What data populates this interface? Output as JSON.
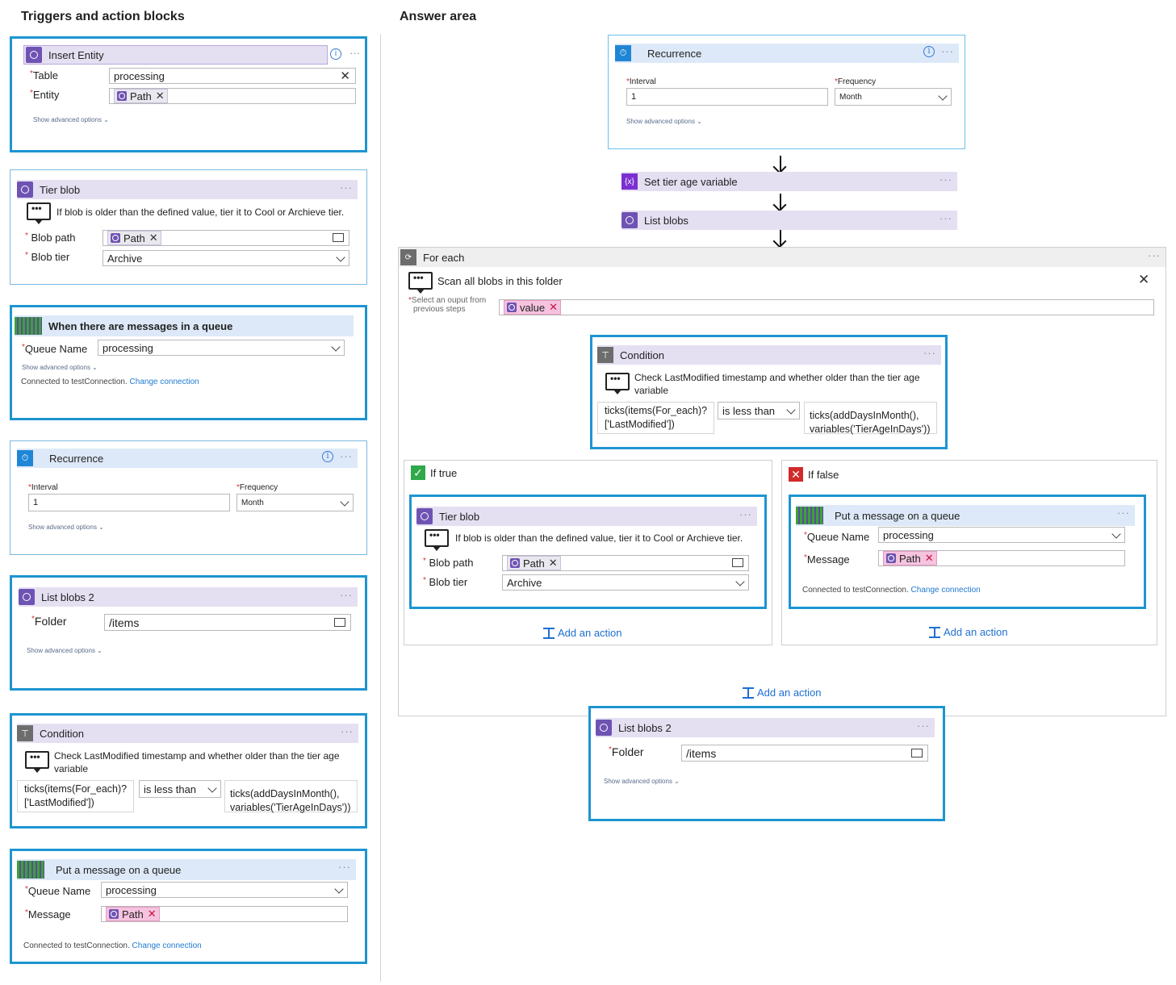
{
  "left_heading": "Triggers and action blocks",
  "right_heading": "Answer area",
  "insert_entity": {
    "title": "Insert Entity",
    "table_label": "Table",
    "table_value": "processing",
    "entity_label": "Entity",
    "entity_token": "Path",
    "advanced": "Show advanced options"
  },
  "tier_blob": {
    "title": "Tier blob",
    "comment": "If blob is older than the defined value, tier it to Cool or Archieve tier.",
    "blob_path_label": "Blob path",
    "blob_path_token": "Path",
    "blob_tier_label": "Blob tier",
    "blob_tier_value": "Archive"
  },
  "queue_trigger": {
    "title": "When there are messages in a queue",
    "queue_label": "Queue Name",
    "queue_value": "processing",
    "advanced": "Show advanced options",
    "connected": "Connected to testConnection.",
    "change": "Change connection"
  },
  "recurrence_left": {
    "title": "Recurrence",
    "interval_label": "Interval",
    "interval_value": "1",
    "frequency_label": "Frequency",
    "frequency_value": "Month",
    "advanced": "Show advanced options"
  },
  "list_blobs_left": {
    "title": "List blobs 2",
    "folder_label": "Folder",
    "folder_value": "/items",
    "advanced": "Show advanced options"
  },
  "condition_left": {
    "title": "Condition",
    "comment": "Check LastModified timestamp and whether older than the tier age variable",
    "left_operand": "ticks(items(For_each)?['LastModified'])",
    "operator": "is less than",
    "right_operand": "ticks(addDaysInMonth(), variables('TierAgeInDays'))"
  },
  "put_message_left": {
    "title": "Put a message on a queue",
    "queue_label": "Queue Name",
    "queue_value": "processing",
    "message_label": "Message",
    "message_token": "Path",
    "connected": "Connected to testConnection.",
    "change": "Change connection"
  },
  "answer": {
    "recurrence": {
      "title": "Recurrence",
      "interval_label": "Interval",
      "interval_value": "1",
      "frequency_label": "Frequency",
      "frequency_value": "Month",
      "advanced": "Show advanced options"
    },
    "set_var": {
      "title": "Set tier age variable",
      "icon_text": "{x}"
    },
    "list_blobs": {
      "title": "List blobs"
    },
    "foreach": {
      "title": "For each",
      "comment": "Scan all blobs in this folder",
      "select_label_1": "Select an ouput from",
      "select_label_2": "previous steps",
      "token": "value"
    },
    "condition": {
      "title": "Condition",
      "comment": "Check LastModified timestamp and whether older than the tier age variable",
      "left_operand": "ticks(items(For_each)?['LastModified'])",
      "operator": "is less than",
      "right_operand": "ticks(addDaysInMonth(), variables('TierAgeInDays'))"
    },
    "if_true": {
      "title": "If true",
      "tier_title": "Tier blob",
      "tier_comment": "If blob is older than the defined value, tier it to Cool or Archieve tier.",
      "blob_path_label": "Blob path",
      "blob_path_token": "Path",
      "blob_tier_label": "Blob tier",
      "blob_tier_value": "Archive",
      "add_action": "Add an action"
    },
    "if_false": {
      "title": "If false",
      "put_title": "Put a message on a queue",
      "queue_label": "Queue Name",
      "queue_value": "processing",
      "message_label": "Message",
      "message_token": "Path",
      "connected": "Connected to testConnection.",
      "change": "Change connection",
      "add_action": "Add an action"
    },
    "add_action": "Add an action",
    "list_blobs2": {
      "title": "List blobs 2",
      "folder_label": "Folder",
      "folder_value": "/items",
      "advanced": "Show advanced options"
    }
  }
}
